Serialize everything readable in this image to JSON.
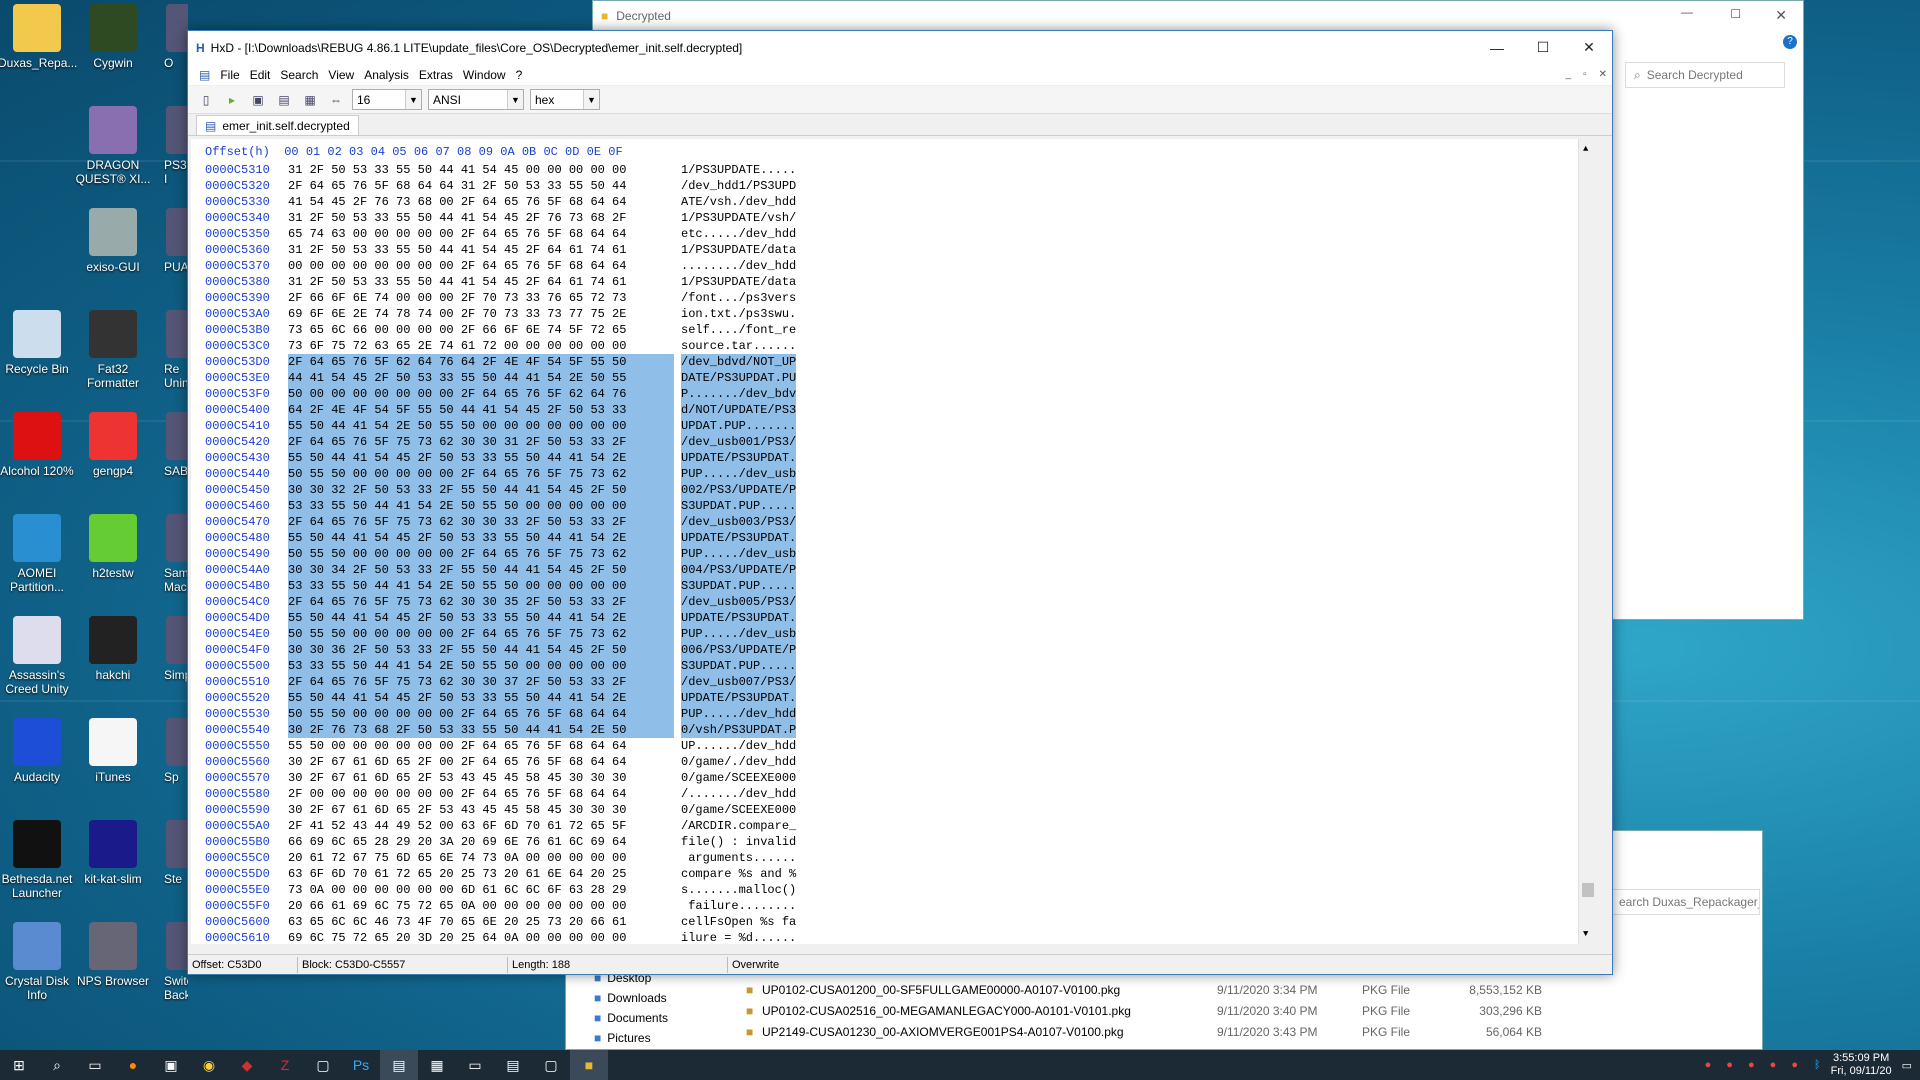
{
  "desktop_icons": [
    {
      "label": "Duxas_Repa...",
      "icon": "folder-icon",
      "color": "#f2c94c",
      "col": 0,
      "row": 0
    },
    {
      "label": "Cygwin",
      "icon": "cygwin-icon",
      "color": "#2d4a22",
      "col": 1,
      "row": 0
    },
    {
      "label": "DRAGON QUEST® XI...",
      "icon": "game-icon",
      "color": "#8a6fb0",
      "col": 1,
      "row": 1
    },
    {
      "label": "exiso-GUI",
      "icon": "disc-icon",
      "color": "#9aa",
      "col": 1,
      "row": 2
    },
    {
      "label": "Recycle Bin",
      "icon": "recycle-bin-icon",
      "color": "#cde",
      "col": 0,
      "row": 3
    },
    {
      "label": "Fat32 Formatter",
      "icon": "fat32-icon",
      "color": "#333",
      "col": 1,
      "row": 3
    },
    {
      "label": "Alcohol 120%",
      "icon": "alcohol-icon",
      "color": "#d11",
      "col": 0,
      "row": 4
    },
    {
      "label": "gengp4",
      "icon": "gengp4-icon",
      "color": "#e33",
      "col": 1,
      "row": 4
    },
    {
      "label": "AOMEI Partition...",
      "icon": "aomei-icon",
      "color": "#2a8fd0",
      "col": 0,
      "row": 5
    },
    {
      "label": "h2testw",
      "icon": "check-icon",
      "color": "#6c3",
      "col": 1,
      "row": 5
    },
    {
      "label": "Assassin's Creed Unity",
      "icon": "assassin-icon",
      "color": "#dde",
      "col": 0,
      "row": 6
    },
    {
      "label": "hakchi",
      "icon": "hakchi-icon",
      "color": "#222",
      "col": 1,
      "row": 6
    },
    {
      "label": "Audacity",
      "icon": "audacity-icon",
      "color": "#1c4fd6",
      "col": 0,
      "row": 7
    },
    {
      "label": "iTunes",
      "icon": "itunes-icon",
      "color": "#f6f6f6",
      "col": 1,
      "row": 7
    },
    {
      "label": "Bethesda.net Launcher",
      "icon": "bethesda-icon",
      "color": "#111",
      "col": 0,
      "row": 8
    },
    {
      "label": "kit-kat-slim",
      "icon": "kitkat-icon",
      "color": "#1a1a8a",
      "col": 1,
      "row": 8
    },
    {
      "label": "Crystal Disk Info",
      "icon": "crystaldisk-icon",
      "color": "#5a8ad0",
      "col": 0,
      "row": 9
    },
    {
      "label": "NPS Browser",
      "icon": "nps-icon",
      "color": "#667",
      "col": 1,
      "row": 9
    }
  ],
  "partial_icons": [
    "O",
    "PS3-I",
    "PUA",
    "Re Unin",
    "SAB",
    "Sam Mac",
    "Simp",
    "Sp",
    "Ste",
    "Switch Backu..."
  ],
  "back_explorer": {
    "title": "Decrypted",
    "search_placeholder": "Search Decrypted"
  },
  "back_explorer2": {
    "search_placeholder": "earch Duxas_Repackager_O..."
  },
  "hxd": {
    "title": "HxD - [I:\\Downloads\\REBUG 4.86.1 LITE\\update_files\\Core_OS\\Decrypted\\emer_init.self.decrypted]",
    "menu": [
      "File",
      "Edit",
      "Search",
      "View",
      "Analysis",
      "Extras",
      "Window",
      "?"
    ],
    "bytes_per_row": "16",
    "charset": "ANSI",
    "mode": "hex",
    "tab": "emer_init.self.decrypted",
    "header": "Offset(h)  00 01 02 03 04 05 06 07 08 09 0A 0B 0C 0D 0E 0F",
    "rows": [
      [
        "0000C5310",
        "31 2F 50 53 33 55 50 44 41 54 45 00 00 00 00 00",
        "1/PS3UPDATE.....",
        0
      ],
      [
        "0000C5320",
        "2F 64 65 76 5F 68 64 64 31 2F 50 53 33 55 50 44",
        "/dev_hdd1/PS3UPD",
        0
      ],
      [
        "0000C5330",
        "41 54 45 2F 76 73 68 00 2F 64 65 76 5F 68 64 64",
        "ATE/vsh./dev_hdd",
        0
      ],
      [
        "0000C5340",
        "31 2F 50 53 33 55 50 44 41 54 45 2F 76 73 68 2F",
        "1/PS3UPDATE/vsh/",
        0
      ],
      [
        "0000C5350",
        "65 74 63 00 00 00 00 00 2F 64 65 76 5F 68 64 64",
        "etc...../dev_hdd",
        0
      ],
      [
        "0000C5360",
        "31 2F 50 53 33 55 50 44 41 54 45 2F 64 61 74 61",
        "1/PS3UPDATE/data",
        0
      ],
      [
        "0000C5370",
        "00 00 00 00 00 00 00 00 2F 64 65 76 5F 68 64 64",
        "......../dev_hdd",
        0
      ],
      [
        "0000C5380",
        "31 2F 50 53 33 55 50 44 41 54 45 2F 64 61 74 61",
        "1/PS3UPDATE/data",
        0
      ],
      [
        "0000C5390",
        "2F 66 6F 6E 74 00 00 00 2F 70 73 33 76 65 72 73",
        "/font.../ps3vers",
        0
      ],
      [
        "0000C53A0",
        "69 6F 6E 2E 74 78 74 00 2F 70 73 33 73 77 75 2E",
        "ion.txt./ps3swu.",
        0
      ],
      [
        "0000C53B0",
        "73 65 6C 66 00 00 00 00 2F 66 6F 6E 74 5F 72 65",
        "self..../font_re",
        0
      ],
      [
        "0000C53C0",
        "73 6F 75 72 63 65 2E 74 61 72 00 00 00 00 00 00",
        "source.tar......",
        0
      ],
      [
        "0000C53D0",
        "2F 64 65 76 5F 62 64 76 64 2F 4E 4F 54 5F 55 50",
        "/dev_bdvd/NOT_UP",
        1
      ],
      [
        "0000C53E0",
        "44 41 54 45 2F 50 53 33 55 50 44 41 54 2E 50 55",
        "DATE/PS3UPDAT.PU",
        1
      ],
      [
        "0000C53F0",
        "50 00 00 00 00 00 00 00 2F 64 65 76 5F 62 64 76",
        "P......./dev_bdv",
        1
      ],
      [
        "0000C5400",
        "64 2F 4E 4F 54 5F 55 50 44 41 54 45 2F 50 53 33",
        "d/NOT/UPDATE/PS3",
        1
      ],
      [
        "0000C5410",
        "55 50 44 41 54 2E 50 55 50 00 00 00 00 00 00 00",
        "UPDAT.PUP.......",
        1
      ],
      [
        "0000C5420",
        "2F 64 65 76 5F 75 73 62 30 30 31 2F 50 53 33 2F",
        "/dev_usb001/PS3/",
        1
      ],
      [
        "0000C5430",
        "55 50 44 41 54 45 2F 50 53 33 55 50 44 41 54 2E",
        "UPDATE/PS3UPDAT.",
        1
      ],
      [
        "0000C5440",
        "50 55 50 00 00 00 00 00 2F 64 65 76 5F 75 73 62",
        "PUP...../dev_usb",
        1
      ],
      [
        "0000C5450",
        "30 30 32 2F 50 53 33 2F 55 50 44 41 54 45 2F 50",
        "002/PS3/UPDATE/P",
        1
      ],
      [
        "0000C5460",
        "53 33 55 50 44 41 54 2E 50 55 50 00 00 00 00 00",
        "S3UPDAT.PUP.....",
        1
      ],
      [
        "0000C5470",
        "2F 64 65 76 5F 75 73 62 30 30 33 2F 50 53 33 2F",
        "/dev_usb003/PS3/",
        1
      ],
      [
        "0000C5480",
        "55 50 44 41 54 45 2F 50 53 33 55 50 44 41 54 2E",
        "UPDATE/PS3UPDAT.",
        1
      ],
      [
        "0000C5490",
        "50 55 50 00 00 00 00 00 2F 64 65 76 5F 75 73 62",
        "PUP...../dev_usb",
        1
      ],
      [
        "0000C54A0",
        "30 30 34 2F 50 53 33 2F 55 50 44 41 54 45 2F 50",
        "004/PS3/UPDATE/P",
        1
      ],
      [
        "0000C54B0",
        "53 33 55 50 44 41 54 2E 50 55 50 00 00 00 00 00",
        "S3UPDAT.PUP.....",
        1
      ],
      [
        "0000C54C0",
        "2F 64 65 76 5F 75 73 62 30 30 35 2F 50 53 33 2F",
        "/dev_usb005/PS3/",
        1
      ],
      [
        "0000C54D0",
        "55 50 44 41 54 45 2F 50 53 33 55 50 44 41 54 2E",
        "UPDATE/PS3UPDAT.",
        1
      ],
      [
        "0000C54E0",
        "50 55 50 00 00 00 00 00 2F 64 65 76 5F 75 73 62",
        "PUP...../dev_usb",
        1
      ],
      [
        "0000C54F0",
        "30 30 36 2F 50 53 33 2F 55 50 44 41 54 45 2F 50",
        "006/PS3/UPDATE/P",
        1
      ],
      [
        "0000C5500",
        "53 33 55 50 44 41 54 2E 50 55 50 00 00 00 00 00",
        "S3UPDAT.PUP.....",
        1
      ],
      [
        "0000C5510",
        "2F 64 65 76 5F 75 73 62 30 30 37 2F 50 53 33 2F",
        "/dev_usb007/PS3/",
        1
      ],
      [
        "0000C5520",
        "55 50 44 41 54 45 2F 50 53 33 55 50 44 41 54 2E",
        "UPDATE/PS3UPDAT.",
        1
      ],
      [
        "0000C5530",
        "50 55 50 00 00 00 00 00 2F 64 65 76 5F 68 64 64",
        "PUP...../dev_hdd",
        1
      ],
      [
        "0000C5540",
        "30 2F 76 73 68 2F 50 53 33 55 50 44 41 54 2E 50",
        "0/vsh/PS3UPDAT.P",
        1
      ],
      [
        "0000C5550",
        "55 50 00 00 00 00 00 00 2F 64 65 76 5F 68 64 64",
        "UP....../dev_hdd",
        2
      ],
      [
        "0000C5560",
        "30 2F 67 61 6D 65 2F 00 2F 64 65 76 5F 68 64 64",
        "0/game/./dev_hdd",
        0
      ],
      [
        "0000C5570",
        "30 2F 67 61 6D 65 2F 53 43 45 45 58 45 30 30 30",
        "0/game/SCEEXE000",
        0
      ],
      [
        "0000C5580",
        "2F 00 00 00 00 00 00 00 2F 64 65 76 5F 68 64 64",
        "/......./dev_hdd",
        0
      ],
      [
        "0000C5590",
        "30 2F 67 61 6D 65 2F 53 43 45 45 58 45 30 30 30",
        "0/game/SCEEXE000",
        0
      ],
      [
        "0000C55A0",
        "2F 41 52 43 44 49 52 00 63 6F 6D 70 61 72 65 5F",
        "/ARCDIR.compare_",
        0
      ],
      [
        "0000C55B0",
        "66 69 6C 65 28 29 20 3A 20 69 6E 76 61 6C 69 64",
        "file() : invalid",
        0
      ],
      [
        "0000C55C0",
        "20 61 72 67 75 6D 65 6E 74 73 0A 00 00 00 00 00",
        " arguments......",
        0
      ],
      [
        "0000C55D0",
        "63 6F 6D 70 61 72 65 20 25 73 20 61 6E 64 20 25",
        "compare %s and %",
        0
      ],
      [
        "0000C55E0",
        "73 0A 00 00 00 00 00 00 6D 61 6C 6C 6F 63 28 29",
        "s.......malloc()",
        0
      ],
      [
        "0000C55F0",
        "20 66 61 69 6C 75 72 65 0A 00 00 00 00 00 00 00",
        " failure........",
        0
      ],
      [
        "0000C5600",
        "63 65 6C 6C 46 73 4F 70 65 6E 20 25 73 20 66 61",
        "cellFsOpen %s fa",
        0
      ],
      [
        "0000C5610",
        "69 6C 75 72 65 20 3D 20 25 64 0A 00 00 00 00 00",
        "ilure = %d......",
        0
      ]
    ],
    "status": {
      "offset": "Offset: C53D0",
      "block": "Block: C53D0-C5557",
      "length": "Length: 188",
      "mode": "Overwrite"
    }
  },
  "explorer_nav": [
    "Desktop",
    "Downloads",
    "Documents",
    "Pictures"
  ],
  "files": [
    {
      "name": "UP0102-CUSA01200_00-SF5FULLGAME00000-A0107-V0100.pkg",
      "date": "9/11/2020 3:34 PM",
      "type": "PKG File",
      "size": "8,553,152 KB"
    },
    {
      "name": "UP0102-CUSA02516_00-MEGAMANLEGACY000-A0101-V0101.pkg",
      "date": "9/11/2020 3:40 PM",
      "type": "PKG File",
      "size": "303,296 KB"
    },
    {
      "name": "UP2149-CUSA01230_00-AXIOMVERGE001PS4-A0107-V0100.pkg",
      "date": "9/11/2020 3:43 PM",
      "type": "PKG File",
      "size": "56,064 KB"
    }
  ],
  "clock": {
    "time": "3:55:09 PM",
    "date": "Fri, 09/11/20"
  }
}
